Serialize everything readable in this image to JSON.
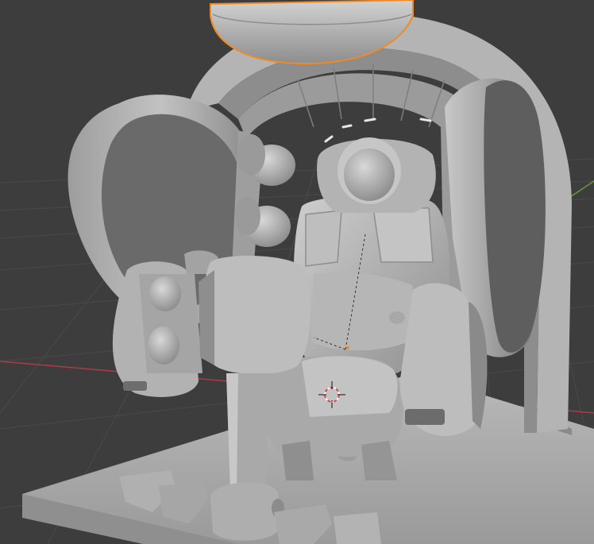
{
  "viewport": {
    "colors": {
      "background": "#3d3d3d",
      "grid_line": "#4a4a4a",
      "x_axis": "#b03a44",
      "y_axis": "#6a9a3c",
      "selection_outline": "#f08a24",
      "model_light": "#c9c9c9",
      "model_mid": "#a4a4a4",
      "model_dark": "#7c7c7c",
      "model_shadow": "#5a5a5a",
      "cursor_red": "#e04848",
      "cursor_white": "#ffffff"
    },
    "selected_object": "canopy-dome",
    "objects": [
      "base-plate",
      "arch-frame",
      "canopy-dome",
      "left-hatch-door",
      "right-hatch-door",
      "pilot-seat",
      "headrest",
      "control-stick",
      "left-control-panel",
      "right-armrest",
      "floor-pedals",
      "seat-cables"
    ],
    "icons": [
      "3d-cursor-icon",
      "origin-dot-icon",
      "parent-relation-line-icon"
    ]
  }
}
